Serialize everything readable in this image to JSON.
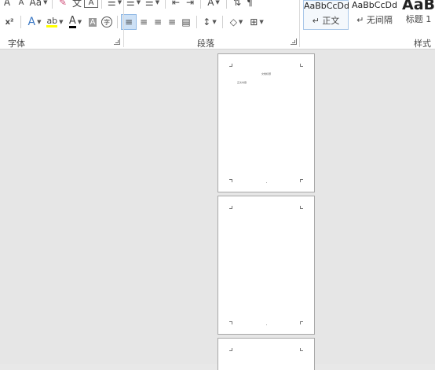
{
  "ribbon": {
    "font_group": {
      "label": "字体",
      "grow_font": "A",
      "shrink_font": "A",
      "change_case": "Aa",
      "superscript": "x²",
      "text_effect": "A",
      "font_color": "A",
      "char_shading": "A",
      "enclose_char": "字"
    },
    "paragraph_group": {
      "label": "段落"
    },
    "styles_group": {
      "label": "样式",
      "items": [
        {
          "sample": "AaBbCcDd",
          "name": "↵ 正文"
        },
        {
          "sample": "AaBbCcDd",
          "name": "↵ 无间隔"
        },
        {
          "sample": "AaB",
          "name": "标题 1"
        }
      ]
    }
  },
  "document": {
    "page1": {
      "title": "文档标题",
      "line": "正文内容"
    }
  },
  "colors": {
    "highlight": "#ffff00",
    "font_color": "#c00000",
    "accent": "#2b579a"
  }
}
